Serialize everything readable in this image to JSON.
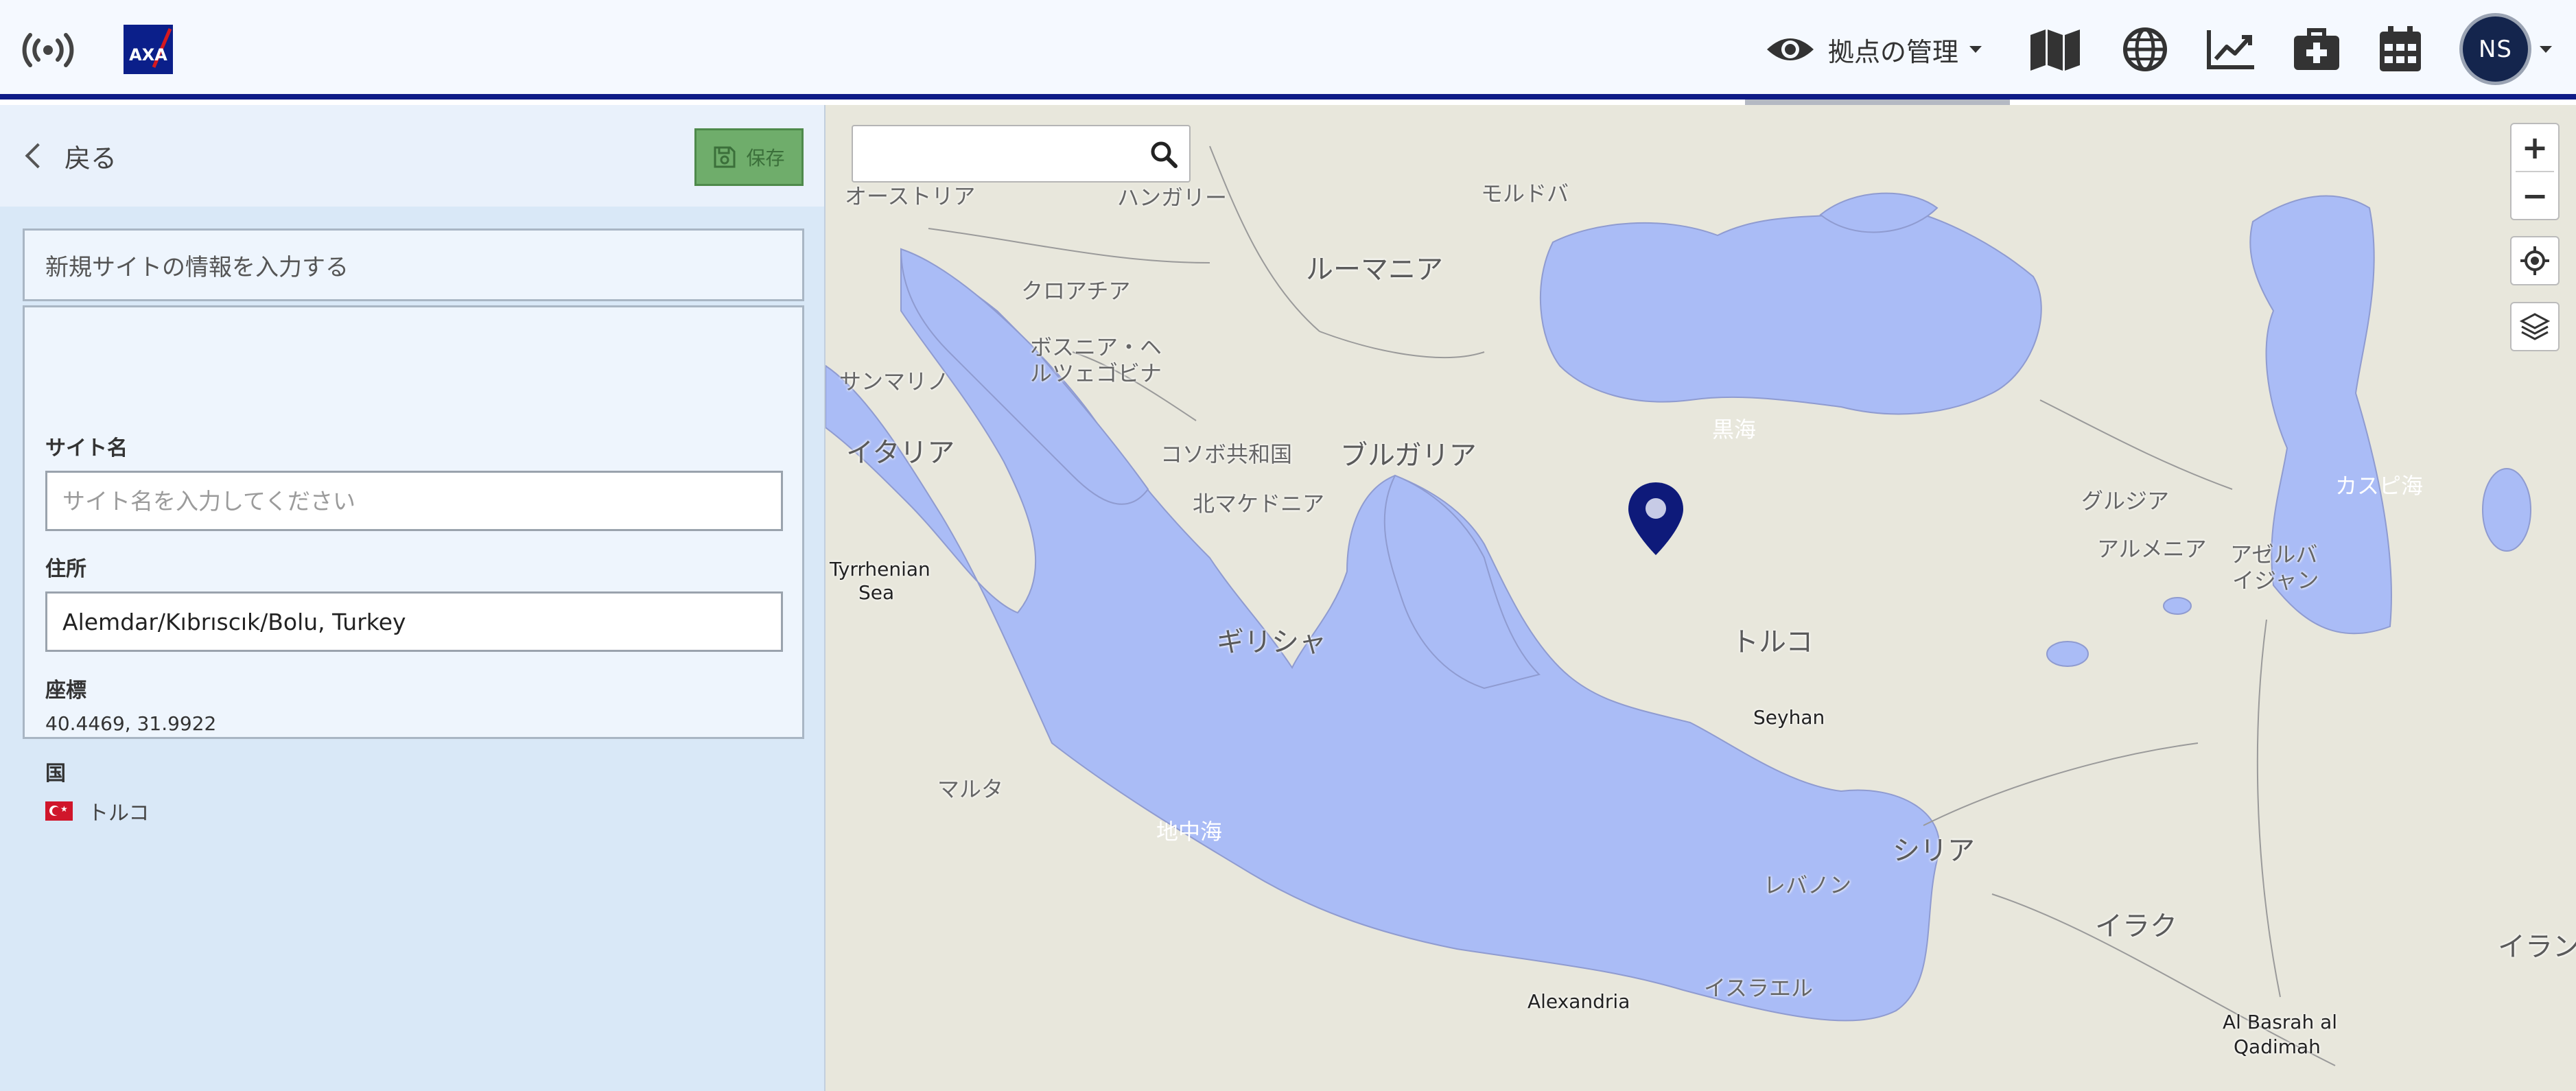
{
  "header": {
    "manage_label": "拠点の管理",
    "brand_logo_text": "AXA",
    "user_initials": "NS"
  },
  "panel": {
    "back_label": "戻る",
    "save_label": "保存",
    "section_title": "新規サイトの情報を入力する",
    "site_name": {
      "label": "サイト名",
      "placeholder": "サイト名を入力してください",
      "value": ""
    },
    "address": {
      "label": "住所",
      "value": "Alemdar/Kıbrıscık/Bolu, Turkey"
    },
    "coordinates": {
      "label": "座標",
      "value": "40.4469, 31.9922"
    },
    "country": {
      "label": "国",
      "value": "トルコ",
      "flag": "turkey-flag"
    }
  },
  "map": {
    "search_placeholder": "",
    "zoom_in": "+",
    "zoom_out": "−",
    "labels": {
      "austria": "オーストリア",
      "hungary": "ハンガリー",
      "moldova": "モルドバ",
      "romania": "ルーマニア",
      "croatia": "クロアチア",
      "bosnia_1": "ボスニア・ヘ",
      "bosnia_2": "ルツェゴビナ",
      "san_marino": "サンマリノ",
      "italy": "イタリア",
      "kosovo": "コソボ共和国",
      "bulgaria": "ブルガリア",
      "north_macedonia": "北マケドニア",
      "black_sea": "黒海",
      "georgia": "グルジア",
      "armenia": "アルメニア",
      "azerbaijan_1": "アゼルバ",
      "azerbaijan_2": "イジャン",
      "caspian": "カスピ海",
      "tyrrhenian_1": "Tyrrhenian",
      "tyrrhenian_2": "Sea",
      "greece": "ギリシャ",
      "turkey": "トルコ",
      "seyhan": "Seyhan",
      "malta": "マルタ",
      "mediterranean": "地中海",
      "syria": "シリア",
      "lebanon": "レバノン",
      "iraq": "イラク",
      "iran": "イラン",
      "israel": "イスラエル",
      "alexandria": "Alexandria",
      "basrah_1": "Al Basrah al",
      "basrah_2": "Qadimah"
    }
  },
  "colors": {
    "nav_border": "#0f1c87",
    "water": "#aabcf6",
    "land": "#e8e7dc",
    "save_green": "#6fad6b",
    "pin": "#0e1a7a"
  }
}
